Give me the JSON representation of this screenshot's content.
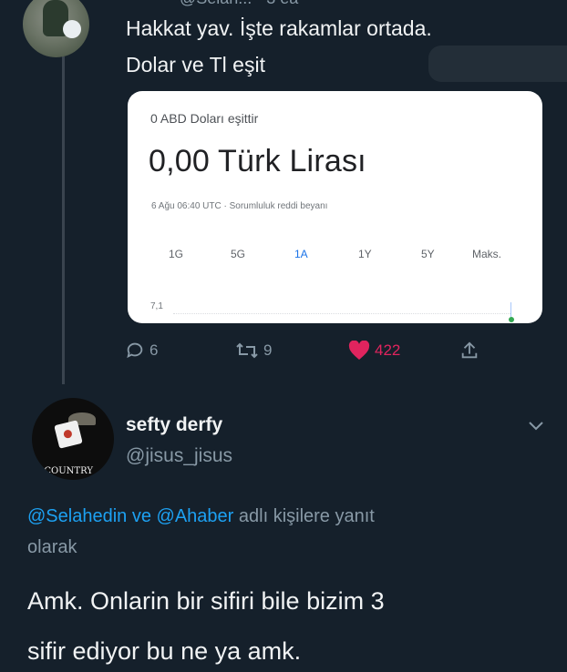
{
  "tweet1": {
    "header_partial": "········· @Selah... · 3 ea",
    "text_line1": "Hakkat yav. İşte rakamlar ortada.",
    "text_line2": "Dolar ve Tl eşit",
    "card": {
      "subtitle": "0 ABD Doları eşittir",
      "value": "0,00 Türk Lirası",
      "timestamp": "6 Ağu 06:40 UTC · Sorumluluk reddi beyanı",
      "tabs": [
        "1G",
        "5G",
        "1A",
        "1Y",
        "5Y",
        "Maks."
      ],
      "selected_tab": "1A",
      "axis_label": "7,1",
      "accent_color": "#1a73e8",
      "line_color": "#34a853"
    },
    "actions": {
      "replies": "6",
      "retweets": "9",
      "likes": "422",
      "like_color": "#e0245e"
    }
  },
  "reply": {
    "name": "sefty derfy",
    "handle": "@jisus_jisus",
    "avatar_text": "ARK COUNTRY",
    "reply_to_mention1": "@Selahedin",
    "reply_to_ve": "ve",
    "reply_to_mention2": "@Ahaber",
    "reply_to_suffix": "adlı kişilere yanıt",
    "reply_to_line2": "olarak",
    "body_line1": "Amk. Onlarin bir sifiri bile bizim 3",
    "body_line2": "sifir ediyor bu ne ya amk."
  },
  "colors": {
    "background": "#15202b",
    "link": "#1da1f2",
    "muted": "#8899a6"
  }
}
